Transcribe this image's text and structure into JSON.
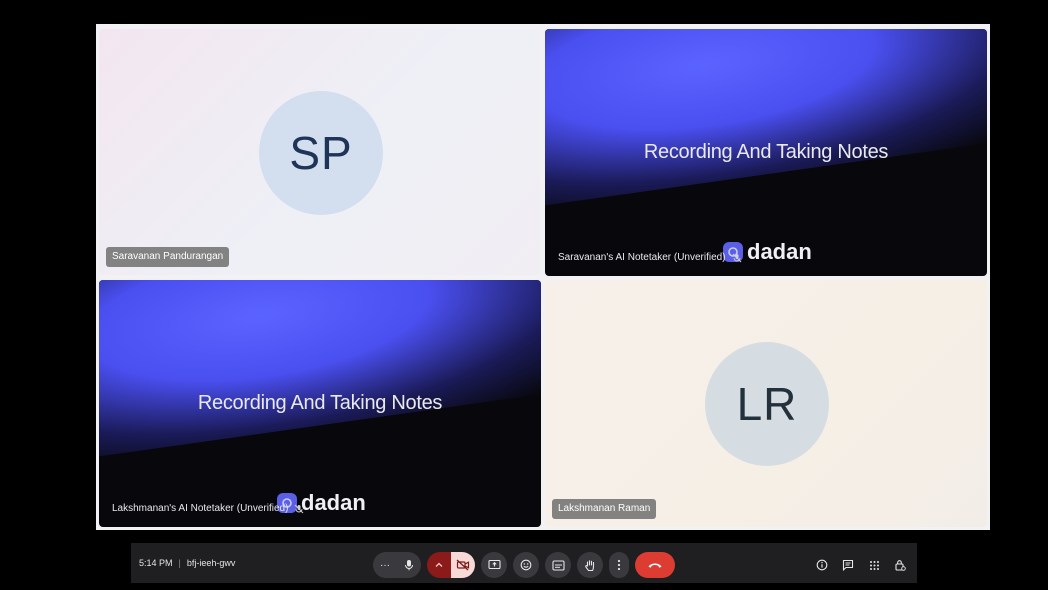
{
  "tiles": [
    {
      "id": "t1",
      "type": "avatar",
      "initials": "SP",
      "name": "Saravanan Pandurangan"
    },
    {
      "id": "t2",
      "type": "notetaker",
      "headline": "Recording And Taking Notes",
      "brand": "dadan",
      "name": "Saravanan's AI Notetaker (Unverified)",
      "muted": true
    },
    {
      "id": "t3",
      "type": "notetaker",
      "headline": "Recording And Taking Notes",
      "brand": "dadan",
      "name": "Lakshmanan's AI Notetaker (Unverified)",
      "muted": true
    },
    {
      "id": "t4",
      "type": "avatar",
      "initials": "LR",
      "name": "Lakshmanan Raman"
    }
  ],
  "toolbar": {
    "time": "5:14 PM",
    "meeting_code": "bfj-ieeh-gwv",
    "more_label": "···",
    "separator": "|"
  },
  "icons": {
    "mic": "microphone-icon",
    "camera_off": "camera-off-icon",
    "present": "present-screen-icon",
    "emoji": "emoji-icon",
    "captions": "captions-icon",
    "raise_hand": "raise-hand-icon",
    "more_vert": "more-options-icon",
    "end_call": "end-call-icon",
    "info": "info-icon",
    "chat": "chat-icon",
    "activities": "activities-icon",
    "host_controls": "host-controls-icon"
  },
  "colors": {
    "end_call": "#dd3c32",
    "camera_off_bg": "#8b1a1a",
    "accent_glow": "#5b63ff"
  }
}
